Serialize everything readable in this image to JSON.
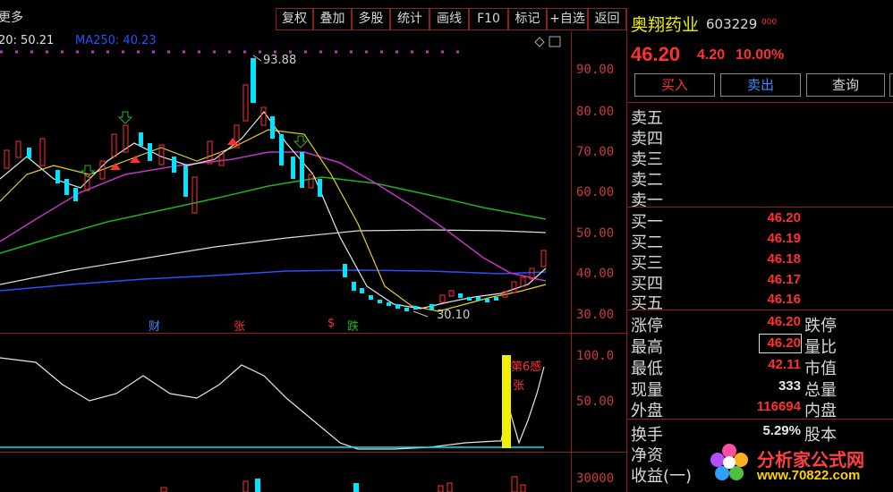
{
  "toolbar": {
    "more": "更多",
    "buttons": [
      "复权",
      "叠加",
      "多股",
      "统计",
      "画线",
      "F10",
      "标记",
      "+自选",
      "返回"
    ]
  },
  "ma_readout": {
    "ma20": "20: 50.21",
    "ma250": "MA250: 40.23"
  },
  "price_axis": [
    "90.00",
    "80.00",
    "70.00",
    "60.00",
    "50.00",
    "40.00",
    "30.00"
  ],
  "annotations": {
    "high": "93.88",
    "low": "30.10",
    "cai": "财",
    "zhang": "张",
    "s": "$",
    "die": "跌"
  },
  "indicator": {
    "axis": [
      "100.0",
      "50.00"
    ],
    "label1": "第6感",
    "label2": "张"
  },
  "volume_axis": "30000",
  "stock": {
    "name": "奥翔药业",
    "code": "603229",
    "tag": "000",
    "price": "46.20",
    "change": "4.20",
    "pct": "10.00%"
  },
  "trade_buttons": {
    "buy": "买入",
    "sell": "卖出",
    "query": "查询"
  },
  "sell_levels": [
    "卖五",
    "卖四",
    "卖三",
    "卖二",
    "卖一"
  ],
  "buy_levels": [
    {
      "label": "买一",
      "price": "46.20"
    },
    {
      "label": "买二",
      "price": "46.19"
    },
    {
      "label": "买三",
      "price": "46.18"
    },
    {
      "label": "买四",
      "price": "46.17"
    },
    {
      "label": "买五",
      "price": "46.16"
    }
  ],
  "stats": [
    {
      "left": "涨停",
      "value": "46.20",
      "right": "跌停"
    },
    {
      "left": "最高",
      "value": "46.20",
      "right": "量比"
    },
    {
      "left": "最低",
      "value": "42.11",
      "right": "市值"
    },
    {
      "left": "现量",
      "value": "333",
      "right": "总量"
    },
    {
      "left": "外盘",
      "value": "116694",
      "right": "内盘"
    },
    {
      "left": "换手",
      "value": "5.29%",
      "right": "股本"
    },
    {
      "left": "净资",
      "value": "",
      "right": ""
    },
    {
      "left": "收益(一)",
      "value": "",
      "right": ""
    }
  ],
  "watermark": {
    "brand": "分析家公式网",
    "url": "www.70822.com"
  },
  "colors": {
    "up": "#ff3030",
    "down": "#00e5ff",
    "grid": "#8c1e1e",
    "ma_white": "#e6e6e6",
    "ma_yellow": "#e6d21e",
    "ma_magenta": "#c832c8",
    "ma_green": "#1eb41e",
    "ma_blue": "#2850ff"
  }
}
